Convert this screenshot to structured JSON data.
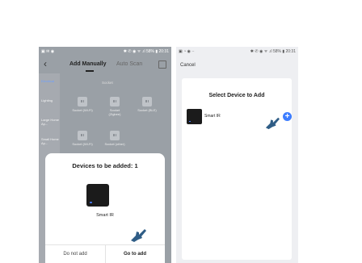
{
  "left": {
    "status_left": "▣ ✉ ◉",
    "status_right": "✱ ✆ ◉ ᯤ .ıl 58% ▮ 20:31",
    "back": "‹",
    "tab_add": "Add Manually",
    "tab_scan": "Auto Scan",
    "categories": [
      "Electrical",
      "Lighting",
      "Large Home Ap...",
      "Small Home Ap..."
    ],
    "section_title": "Socket",
    "devices": [
      "Socket (Wi-Fi)",
      "Socket (Zigbee)",
      "Socket (BLE)",
      "Socket (Wi-Fi)",
      "Socket (other)"
    ],
    "sheet_title": "Devices to be added: 1",
    "device_name": "Smart IR",
    "btn_no": "Do not add",
    "btn_go": "Go to add"
  },
  "right": {
    "status_left": "▣ ◔ ◉ ··",
    "status_right": "✱ ✆ ◉ ᯤ .ıl 58% ▮ 20:31",
    "cancel": "Cancel",
    "card_title": "Select Device to Add",
    "device_name": "Smart IR",
    "plus": "+"
  },
  "colors": {
    "accent": "#3d7dff",
    "hand": "#2f5d86",
    "overlay": "#9aa0a6"
  },
  "icons": [
    "back-arrow-icon",
    "scan-icon",
    "socket-icon",
    "smart-ir-device-icon",
    "plus-icon",
    "pointer-hand-icon"
  ]
}
